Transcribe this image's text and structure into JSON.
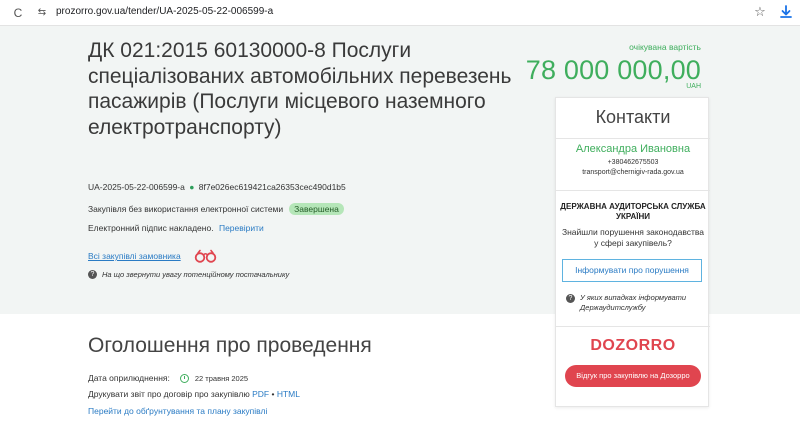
{
  "browser": {
    "url": "prozorro.gov.ua/tender/UA-2025-05-22-006599-a",
    "reload_glyph": "C",
    "site_info_glyph": "⇆",
    "bookmark_glyph": "☆"
  },
  "tender": {
    "title": "ДК 021:2015 60130000-8 Послуги спеціалізованих автомобільних перевезень пасажирів (Послуги місцевого наземного електротранспорту)",
    "id": "UA-2025-05-22-006599-a",
    "separator": "●",
    "hash": "8f7e026ec619421ca26353cec490d1b5",
    "procedure_type": "Закупівля без використання електронної системи",
    "status": "Завершена",
    "signature_text": "Електронний підпис накладено.",
    "signature_check_link": "Перевірити",
    "all_tenders_link": "Всі закупівлі замовника",
    "hint": "На що звернути увагу потенційному постачальнику",
    "help_glyph": "?"
  },
  "value": {
    "label": "очікувана вартість",
    "amount": "78 000 000,00",
    "currency": "UAH"
  },
  "contacts": {
    "title": "Контакти",
    "name": "Александра Ивановна",
    "phone": "+380462675503",
    "email": "transport@chernigiv-rada.gov.ua"
  },
  "audit": {
    "title": "ДЕРЖАВНА АУДИТОРСЬКА СЛУЖБА УКРАЇНИ",
    "question": "Знайшли порушення законодавства у сфері закупівель?",
    "report_button": "Інформувати про порушення",
    "hint": "У яких випадках інформувати Держаудитслужбу"
  },
  "dozorro": {
    "logo": "DOZORRO",
    "button": "Відгук про закупівлю на Дозорро"
  },
  "announcement": {
    "title": "Оголошення про проведення",
    "pub_date_label": "Дата оприлюднення:",
    "pub_date_value": "22 травня 2025",
    "print_text": "Друкувати звіт про договір про закупівлю",
    "pdf_link": "PDF",
    "bullet": "•",
    "html_link": "HTML",
    "justification_link": "Перейти до обґрунтування та плану закупівлі"
  },
  "colors": {
    "accent_green": "#3fae5d",
    "link_blue": "#2a7bc4",
    "dozorro_red": "#e0454f",
    "hero_bg": "#f2f5f4"
  }
}
